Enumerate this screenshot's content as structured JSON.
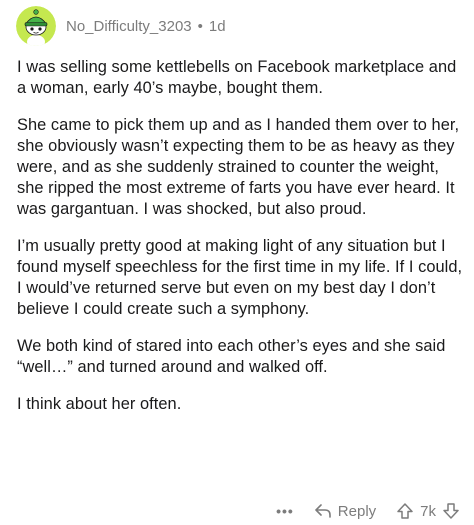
{
  "comment": {
    "username": "No_Difficulty_3203",
    "separator": "•",
    "age": "1d",
    "paragraphs": [
      "I was selling some kettlebells on Facebook marketplace and a woman, early 40’s maybe, bought them.",
      "She came to pick them up and as I handed them over to her, she obviously wasn’t expecting them to be as heavy as they were, and as she suddenly strained to counter the weight, she ripped the most extreme of farts you have ever heard. It was gargantuan. I was shocked, but also proud.",
      "I’m usually pretty good at making light of any situation but I found myself speechless for the first time in my life. If I could, I would’ve returned serve but even on my best day I don’t believe I could create such a symphony.",
      "We both kind of stared into each other’s eyes and she said “well…” and turned around and walked off.",
      "I think about her often."
    ]
  },
  "actions": {
    "more_label": "•••",
    "reply_label": "Reply",
    "vote_count": "7k"
  },
  "icons": {
    "avatar": "snoo-avatar-green",
    "reply": "reply-arrow-icon",
    "upvote": "upvote-arrow-icon",
    "downvote": "downvote-arrow-icon"
  },
  "colors": {
    "avatar_background": "#c5e84f",
    "text": "#1a1a1b",
    "muted": "#7c7c7c"
  }
}
